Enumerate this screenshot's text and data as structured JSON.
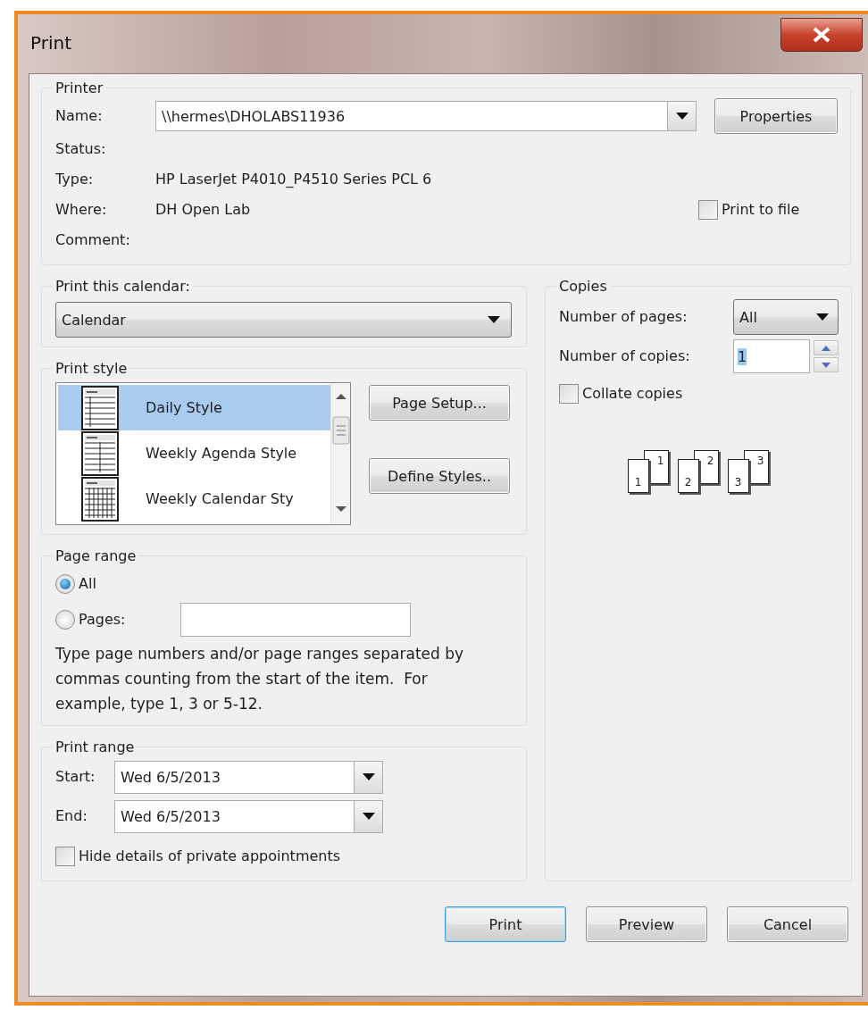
{
  "window": {
    "title": "Print"
  },
  "printer": {
    "title": "Printer",
    "name_label": "Name:",
    "name_value": "\\\\hermes\\DHOLABS11936",
    "properties_button": "Properties",
    "fields": [
      {
        "label": "Status:"
      },
      {
        "label": "Type:",
        "value": "HP LaserJet P4010_P4510 Series PCL 6"
      },
      {
        "label": "Where:",
        "value": "DH Open Lab"
      },
      {
        "label": "Comment:"
      }
    ],
    "print_to_file": {
      "label": "Print to file",
      "checked": false
    }
  },
  "calendar": {
    "title": "Print this calendar:",
    "value": "Calendar"
  },
  "print_style": {
    "title": "Print style",
    "items": [
      {
        "label": "Daily Style",
        "kind": "daily",
        "selected": true
      },
      {
        "label": "Weekly Agenda Style",
        "kind": "agenda",
        "selected": false
      },
      {
        "label": "Weekly Calendar Sty",
        "kind": "calendar",
        "selected": false
      }
    ],
    "buttons": [
      "Page Setup...",
      "Define Styles.."
    ]
  },
  "page_range": {
    "title": "Page range",
    "options": [
      {
        "label": "All",
        "selected": true
      },
      {
        "label": "Pages:",
        "selected": false
      }
    ],
    "note": "Type page numbers and/or page ranges separated by commas counting from the start of the item.  For example, type 1, 3 or 5-12."
  },
  "print_range": {
    "title": "Print range",
    "fields": [
      {
        "label": "Start:",
        "value": "Wed 6/5/2013"
      },
      {
        "label": "End:",
        "value": "Wed 6/5/2013"
      }
    ],
    "hide_private": {
      "label": "Hide details of private appointments",
      "checked": false
    }
  },
  "copies": {
    "title": "Copies",
    "pages_label": "Number of pages:",
    "pages_value": "All",
    "copies_label": "Number of copies:",
    "copies_value": "1",
    "copies_value_selected": true,
    "collate": {
      "label": "Collate copies",
      "checked": false
    },
    "stacks": [
      {
        "front": "1",
        "back": "1"
      },
      {
        "front": "2",
        "back": "2"
      },
      {
        "front": "3",
        "back": "3"
      }
    ]
  },
  "buttons": [
    {
      "label": "Print",
      "default": true
    },
    {
      "label": "Preview",
      "default": false
    },
    {
      "label": "Cancel",
      "default": false
    }
  ]
}
